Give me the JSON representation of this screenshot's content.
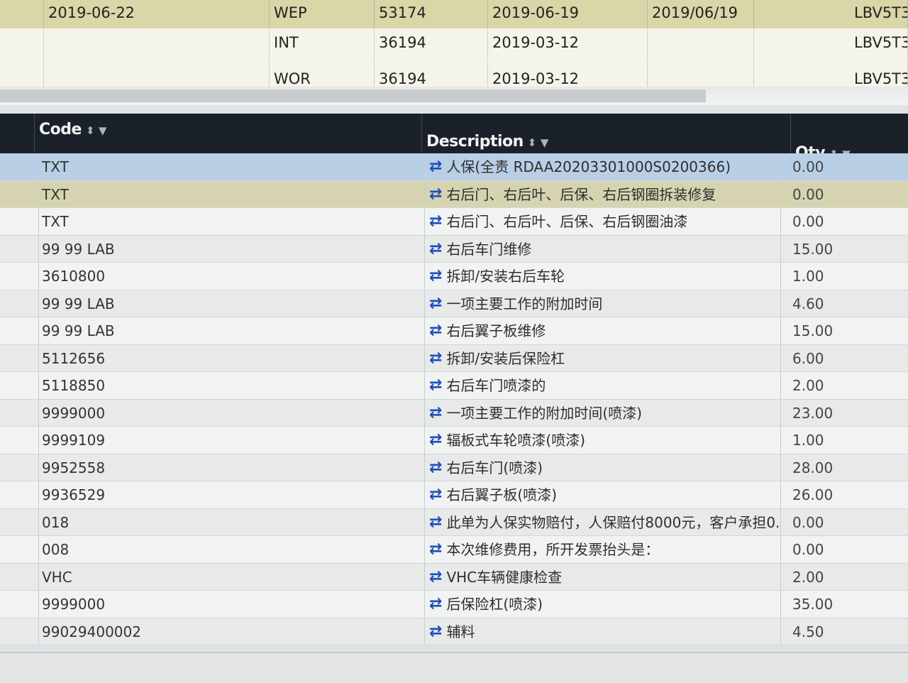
{
  "top_table": {
    "rows": [
      {
        "date": "2019-06-22",
        "type": "WEP",
        "number": "53174",
        "date1": "2019-06-19",
        "date2": "2019/06/19",
        "vin": "LBV5T3"
      },
      {
        "date": "",
        "type": "INT",
        "number": "36194",
        "date1": "2019-03-12",
        "date2": "",
        "vin": "LBV5T3"
      },
      {
        "date": "",
        "type": "WOR",
        "number": "36194",
        "date1": "2019-03-12",
        "date2": "",
        "vin": "LBV5T3"
      }
    ]
  },
  "grid": {
    "columns": {
      "code": "Code",
      "description": "Description",
      "qty": "Qty"
    },
    "header_icons": {
      "sort": "sort-icon",
      "filter": "filter-icon"
    },
    "rows": [
      {
        "code": "TXT",
        "description": "人保(全责 RDAA20203301000S0200366)",
        "qty": "0.00"
      },
      {
        "code": "TXT",
        "description": "右后门、右后叶、后保、右后钢圈拆装修复",
        "qty": "0.00"
      },
      {
        "code": "TXT",
        "description": "右后门、右后叶、后保、右后钢圈油漆",
        "qty": "0.00"
      },
      {
        "code": "99 99 LAB",
        "description": "右后车门维修",
        "qty": "15.00"
      },
      {
        "code": "3610800",
        "description": "拆卸/安装右后车轮",
        "qty": "1.00"
      },
      {
        "code": "99 99 LAB",
        "description": "一项主要工作的附加时间",
        "qty": "4.60"
      },
      {
        "code": "99 99 LAB",
        "description": "右后翼子板维修",
        "qty": "15.00"
      },
      {
        "code": "5112656",
        "description": "拆卸/安装后保险杠",
        "qty": "6.00"
      },
      {
        "code": "5118850",
        "description": "右后车门喷漆的",
        "qty": "2.00"
      },
      {
        "code": "9999000",
        "description": "一项主要工作的附加时间(喷漆)",
        "qty": "23.00"
      },
      {
        "code": "9999109",
        "description": "辐板式车轮喷漆(喷漆)",
        "qty": "1.00"
      },
      {
        "code": "9952558",
        "description": "右后车门(喷漆)",
        "qty": "28.00"
      },
      {
        "code": "9936529",
        "description": "右后翼子板(喷漆)",
        "qty": "26.00"
      },
      {
        "code": "018",
        "description": "此单为人保实物赔付，人保赔付8000元，客户承担0...",
        "qty": "0.00"
      },
      {
        "code": "008",
        "description": "本次维修费用，所开发票抬头是：",
        "qty": "0.00"
      },
      {
        "code": "VHC",
        "description": "VHC车辆健康检查",
        "qty": "2.00"
      },
      {
        "code": "9999000",
        "description": "后保险杠(喷漆)",
        "qty": "35.00"
      },
      {
        "code": "99029400002",
        "description": "辅料",
        "qty": "4.50"
      }
    ]
  },
  "colors": {
    "header_bg": "#1b2129",
    "selected_row": "#b9cfe6",
    "top_row_highlight": "#d9d6a8",
    "swap_icon": "#1d4fb8"
  }
}
